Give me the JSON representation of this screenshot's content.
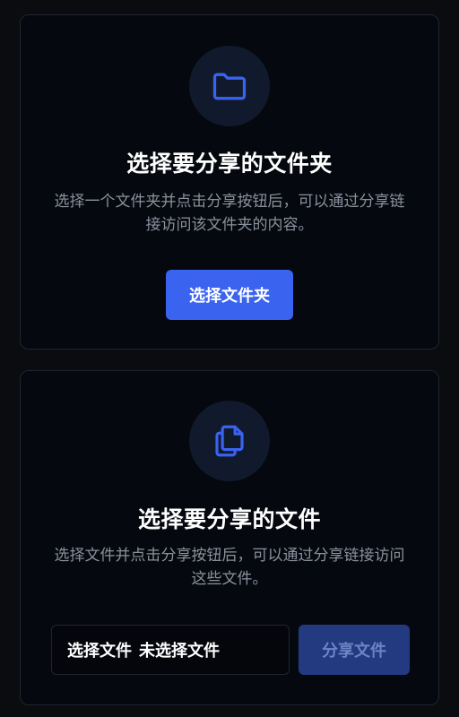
{
  "colors": {
    "background": "#0a0c10",
    "card": "#05080e",
    "border": "#1f2530",
    "accent": "#3a63f0",
    "accent_disabled": "#233a80",
    "icon": "#3a63f0",
    "icon_bg": "#111a2c",
    "muted_text": "#8a919e"
  },
  "folder_card": {
    "icon": "folder-icon",
    "title": "选择要分享的文件夹",
    "description": "选择一个文件夹并点击分享按钮后，可以通过分享链接访问该文件夹的内容。",
    "button_label": "选择文件夹"
  },
  "files_card": {
    "icon": "files-copy-icon",
    "title": "选择要分享的文件",
    "description": "选择文件并点击分享按钮后，可以通过分享链接访问这些文件。",
    "file_input": {
      "button_label": "选择文件",
      "status": "未选择文件"
    },
    "share_button_label": "分享文件"
  }
}
